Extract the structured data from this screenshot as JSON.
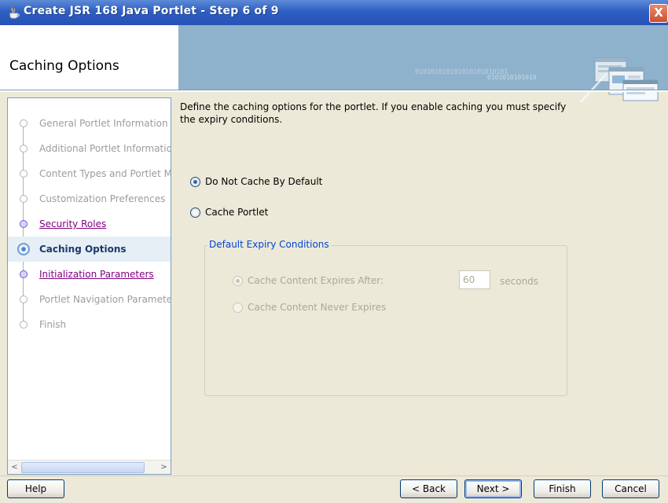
{
  "window": {
    "title": "Create JSR 168 Java Portlet - Step 6 of 9",
    "close_label": "X"
  },
  "banner": {
    "heading": "Caching Options",
    "decor_binary_1": "010101010101010101010101",
    "decor_binary_2": "0101010101010"
  },
  "nav": {
    "steps": [
      {
        "label": "General Portlet Information",
        "state": "disabled"
      },
      {
        "label": "Additional Portlet Information",
        "state": "disabled"
      },
      {
        "label": "Content Types and Portlet Modes",
        "state": "disabled"
      },
      {
        "label": "Customization Preferences",
        "state": "disabled"
      },
      {
        "label": "Security Roles",
        "state": "link"
      },
      {
        "label": "Caching Options",
        "state": "current"
      },
      {
        "label": "Initialization Parameters",
        "state": "link"
      },
      {
        "label": "Portlet Navigation Parameters",
        "state": "disabled"
      },
      {
        "label": "Finish",
        "state": "disabled"
      }
    ],
    "scroll_left": "<",
    "scroll_right": ">"
  },
  "content": {
    "description_line1": "Define the caching options for the portlet. If you enable caching you must specify",
    "description_line2": "the expiry conditions.",
    "option_no_cache": "Do Not Cache By Default",
    "option_cache": "Cache Portlet",
    "selected_option": "Do Not Cache By Default",
    "group_title": "Default Expiry Conditions",
    "expires_after_label": "Cache Content Expires After:",
    "expires_after_value": "60",
    "expires_after_unit": "seconds",
    "never_expires_label": "Cache Content Never Expires"
  },
  "buttons": {
    "help": "Help",
    "back": "< Back",
    "next": "Next >",
    "finish": "Finish",
    "cancel": "Cancel"
  },
  "colors": {
    "titlebar": "#2E5FC3",
    "banner": "#8FB2CC",
    "dialog_bg": "#ECE9D8",
    "link": "#800080",
    "group_title": "#0046D5"
  }
}
